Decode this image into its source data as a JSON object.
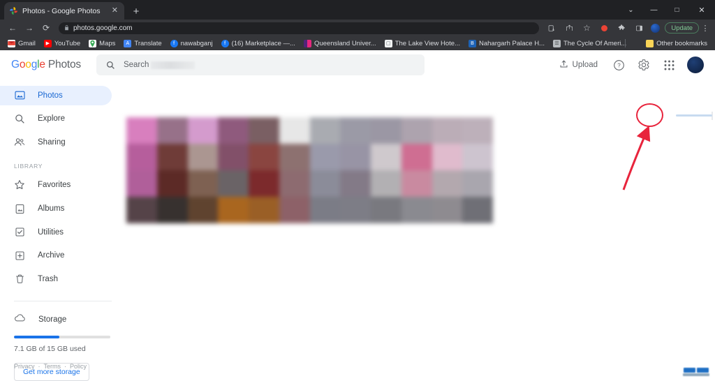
{
  "browser": {
    "tab": {
      "title": "Photos - Google Photos",
      "favicon": "google-photos-favicon",
      "close_label": "✕"
    },
    "new_tab_label": "+",
    "window_controls": [
      {
        "name": "tab-search",
        "glyph": "⌄"
      },
      {
        "name": "minimize",
        "glyph": "—"
      },
      {
        "name": "maximize",
        "glyph": "□"
      },
      {
        "name": "close",
        "glyph": "✕"
      }
    ],
    "nav": {
      "back": "←",
      "forward": "→",
      "reload": "⟳",
      "lock_icon": "🔒",
      "url": "photos.google.com"
    },
    "toolbar_right": {
      "install_icon": "install-icon",
      "share_icon": "share-icon",
      "bookmark_icon": "☆",
      "record_icon": "record-dot-icon",
      "extensions_icon": "🧩",
      "side_panel_icon": "side-panel-icon",
      "profile_icon": "profile-avatar",
      "update_label": "Update",
      "menu_label": "⋮"
    },
    "bookmarks": [
      {
        "label": "Gmail",
        "icon": "gmail-icon",
        "color": "#ea4335"
      },
      {
        "label": "YouTube",
        "icon": "youtube-icon",
        "color": "#ff0000"
      },
      {
        "label": "Maps",
        "icon": "maps-icon",
        "color": "#34a853"
      },
      {
        "label": "Translate",
        "icon": "translate-icon",
        "color": "#4285f4"
      },
      {
        "label": "nawabganj",
        "icon": "facebook-icon",
        "color": "#1877f2"
      },
      {
        "label": "(16) Marketplace —...",
        "icon": "facebook-icon",
        "color": "#1877f2"
      },
      {
        "label": "Queensland Univer...",
        "icon": "university-icon",
        "color": "#b5377f"
      },
      {
        "label": "The Lake View Hote...",
        "icon": "page-icon",
        "color": "#e8eaed"
      },
      {
        "label": "Nahargarh Palace H...",
        "icon": "booking-icon",
        "color": "#1d62b5"
      },
      {
        "label": "The Cycle Of Ameri...",
        "icon": "doc-icon",
        "color": "#b8bcc0"
      }
    ],
    "other_bookmarks": {
      "label": "Other bookmarks",
      "icon": "folder-icon"
    }
  },
  "app": {
    "logo": {
      "g1": "G",
      "o1": "o",
      "o2": "o",
      "g2": "g",
      "l1": "l",
      "e1": "e",
      "word": "Photos"
    },
    "search": {
      "placeholder": "Search",
      "icon": "search-icon"
    },
    "header_actions": {
      "upload_label": "Upload",
      "upload_icon": "upload-icon",
      "help_icon": "help-circle-icon",
      "settings_icon": "gear-icon",
      "apps_icon": "apps-grid-icon",
      "account_avatar": "account-avatar"
    },
    "annotation": {
      "highlight_target": "gear-icon",
      "shape": "circle",
      "color": "#e8243c",
      "arrow": "arrow-pointing-to-settings"
    },
    "sidebar": {
      "primary": [
        {
          "label": "Photos",
          "icon": "photos-icon",
          "active": true
        },
        {
          "label": "Explore",
          "icon": "search-icon",
          "active": false
        },
        {
          "label": "Sharing",
          "icon": "sharing-icon",
          "active": false
        }
      ],
      "library_header": "LIBRARY",
      "library": [
        {
          "label": "Favorites",
          "icon": "star-icon"
        },
        {
          "label": "Albums",
          "icon": "albums-icon"
        },
        {
          "label": "Utilities",
          "icon": "utilities-icon"
        },
        {
          "label": "Archive",
          "icon": "archive-icon"
        },
        {
          "label": "Trash",
          "icon": "trash-icon"
        }
      ],
      "storage": {
        "label": "Storage",
        "icon": "cloud-icon",
        "used_text": "7.1 GB of 15 GB used",
        "percent_used": 47,
        "button_label": "Get more storage",
        "accent_color": "#1a73e8"
      },
      "footer": {
        "privacy": "Privacy",
        "sep1": "·",
        "terms": "Terms",
        "sep2": "·",
        "policy": "Policy"
      }
    },
    "photo_grid": {
      "description": "blurred photo thumbnails grid",
      "columns": 12,
      "rows": 4,
      "tiles": [
        "#d87fbe",
        "#977189",
        "#d49bcd",
        "#8f5a7d",
        "#7a5f63",
        "#e7e7e7",
        "#a9abb1",
        "#9b9aa6",
        "#9b97a4",
        "#ada3ae",
        "#bbadb7",
        "#bdb0ba",
        "#b65e9c",
        "#6f3c38",
        "#ab9691",
        "#825069",
        "#8a4540",
        "#8d7170",
        "#9a9aab",
        "#9894a5",
        "#cfc9cd",
        "#cf6e92",
        "#e0bbcd",
        "#cdc4cf",
        "#b05f9a",
        "#5c2a26",
        "#7e6152",
        "#6a6366",
        "#7c2a2c",
        "#8d6b70",
        "#8b8c99",
        "#837a87",
        "#b2b0b3",
        "#c98aa0",
        "#b3a8ae",
        "#a9a6ae",
        "#554348",
        "#37312f",
        "#5f432f",
        "#a9661f",
        "#9a5f26",
        "#8d6168",
        "#7b7c86",
        "#7d7d86",
        "#79797f",
        "#8a8a90",
        "#8e8b90",
        "#6f6f76"
      ]
    },
    "watermark": "site-watermark"
  }
}
